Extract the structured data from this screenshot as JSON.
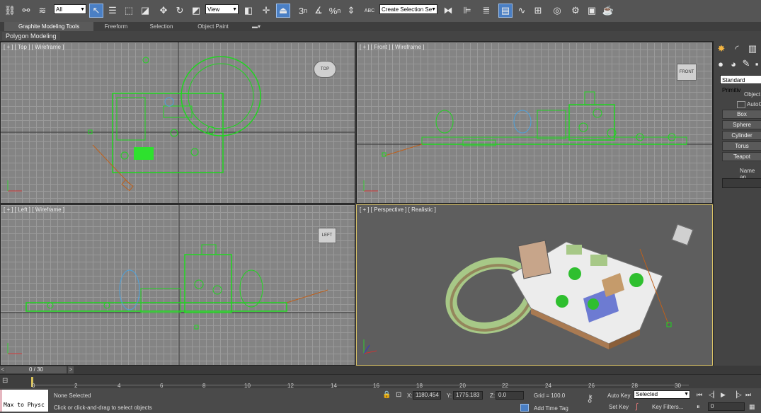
{
  "toolbar": {
    "filter_select": "All",
    "view_select": "View",
    "selection_set": "Create Selection Se",
    "icons": [
      "link-icon",
      "unlink-icon",
      "bind-spacewarp-icon",
      "select-object-icon",
      "select-by-name-icon",
      "rectangle-region-icon",
      "window-crossing-icon",
      "move-icon",
      "rotate-icon",
      "scale-icon",
      "select-manipulate-icon",
      "use-pivot-icon",
      "snaps-toggle-icon",
      "angle-snap-icon",
      "percent-snap-icon",
      "spinner-snap-icon",
      "edit-named-selections-icon",
      "mirror-icon",
      "align-icon",
      "layer-manager-icon",
      "graphite-toggle-icon",
      "curve-editor-icon",
      "schematic-view-icon",
      "material-editor-icon",
      "render-setup-icon",
      "rendered-frame-icon",
      "render-icon"
    ],
    "label_3": "3",
    "label_pct": "%",
    "label_n": "n",
    "label_abc": "ABC"
  },
  "ribbon": {
    "tabs": [
      "Graphite Modeling Tools",
      "Freeform",
      "Selection",
      "Object Paint"
    ],
    "panel_label": "Polygon Modeling"
  },
  "viewports": {
    "top": {
      "label": "[ + ] [ Top ] [ Wireframe ]",
      "cube": "TOP"
    },
    "front": {
      "label": "[ + ] [ Front ] [ Wireframe ]",
      "cube": "FRONT"
    },
    "left": {
      "label": "[ + ] [ Left ] [ Wireframe ]",
      "cube": "LEFT"
    },
    "perspective": {
      "label": "[ + ] [ Perspective ] [ Realistic ]"
    }
  },
  "command_panel": {
    "dropdown": "Standard Primitiv",
    "rollout_object_type": "Object",
    "autogrid": "AutoG",
    "buttons": [
      "Box",
      "Sphere",
      "Cylinder",
      "Torus",
      "Teapot"
    ],
    "rollout_name": "Name an"
  },
  "timeline": {
    "frame_counter": "0 / 30",
    "ticks": [
      "0",
      "2",
      "4",
      "6",
      "8",
      "10",
      "12",
      "14",
      "16",
      "18",
      "20",
      "22",
      "24",
      "26",
      "28",
      "30"
    ]
  },
  "status": {
    "maxscript": "Max to Physc",
    "selection": "None Selected",
    "prompt": "Click or click-and-drag to select objects",
    "x_label": "X:",
    "x_value": "1180.454",
    "y_label": "Y:",
    "y_value": "1775.183",
    "z_label": "Z:",
    "z_value": "0.0",
    "grid": "Grid = 100.0",
    "add_time_tag": "Add Time Tag",
    "auto_key": "Auto Key",
    "set_key": "Set Key",
    "key_mode": "Selected",
    "key_filters": "Key Filters...",
    "current_frame": "0"
  }
}
